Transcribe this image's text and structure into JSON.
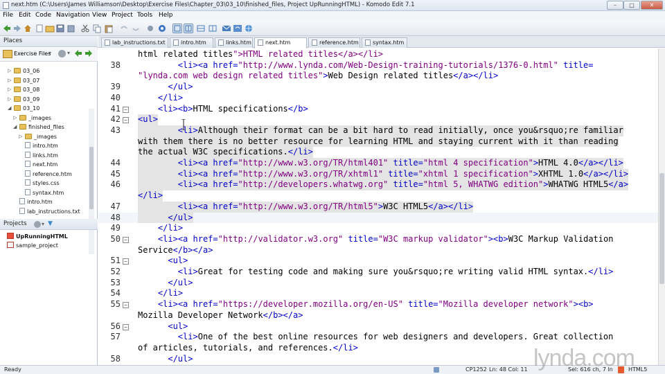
{
  "window": {
    "title": "next.htm (C:\\Users\\James Williamson\\Desktop\\Exercise Files\\Chapter_03\\03_10\\finished_files, Project UpRunningHTML) - Komodo Edit 7.1",
    "controls": [
      "minimize",
      "maximize",
      "close"
    ]
  },
  "menu": [
    "File",
    "Edit",
    "Code",
    "Navigation",
    "View",
    "Project",
    "Tools",
    "Help"
  ],
  "toolbar_icons": [
    "back-icon",
    "forward-icon",
    "home-icon",
    "new-file-icon",
    "open-file-icon",
    "save-icon",
    "save-all-icon",
    "cut-icon",
    "copy-icon",
    "paste-icon",
    "undo-icon",
    "redo-icon",
    "debug-icon",
    "browser-icon",
    "view-icon",
    "split-icon",
    "tree-icon",
    "pane-icon",
    "mail-icon",
    "refresh-icon",
    "globe-icon"
  ],
  "places": {
    "header": "Places",
    "root": "Exercise Files",
    "tree": [
      {
        "label": "03_06",
        "type": "folder",
        "level": 1,
        "expanded": false
      },
      {
        "label": "03_07",
        "type": "folder",
        "level": 1,
        "expanded": false
      },
      {
        "label": "03_08",
        "type": "folder",
        "level": 1,
        "expanded": false
      },
      {
        "label": "03_09",
        "type": "folder",
        "level": 1,
        "expanded": false
      },
      {
        "label": "03_10",
        "type": "folder",
        "level": 1,
        "expanded": true
      },
      {
        "label": "_images",
        "type": "folder",
        "level": 2,
        "expanded": false
      },
      {
        "label": "finished_files",
        "type": "folder",
        "level": 2,
        "expanded": true
      },
      {
        "label": "_images",
        "type": "folder",
        "level": 3,
        "expanded": false
      },
      {
        "label": "intro.htm",
        "type": "file",
        "level": 3
      },
      {
        "label": "links.htm",
        "type": "file",
        "level": 3
      },
      {
        "label": "next.htm",
        "type": "file",
        "level": 3
      },
      {
        "label": "reference.htm",
        "type": "file",
        "level": 3
      },
      {
        "label": "styles.css",
        "type": "file",
        "level": 3
      },
      {
        "label": "syntax.htm",
        "type": "file",
        "level": 3
      },
      {
        "label": "intro.htm",
        "type": "file",
        "level": 2
      },
      {
        "label": "lab_instructions.txt",
        "type": "file",
        "level": 2
      }
    ]
  },
  "projects": {
    "header": "Projects",
    "items": [
      {
        "label": "UpRunningHTML",
        "bold": true
      },
      {
        "label": "sample_project",
        "bold": false
      }
    ]
  },
  "tabs": [
    {
      "label": "lab_instructions.txt",
      "active": false
    },
    {
      "label": "intro.htm",
      "active": false
    },
    {
      "label": "links.htm",
      "active": false
    },
    {
      "label": "next.htm",
      "active": true
    },
    {
      "label": "reference.htm",
      "active": false
    },
    {
      "label": "syntax.htm",
      "active": false
    }
  ],
  "code_lines": [
    {
      "n": "",
      "fold": "",
      "text": "html related titles\">HTML related titles</a></li>"
    },
    {
      "n": "38",
      "fold": "",
      "text": "        <li><a href=\"http://www.lynda.com/Web-Design-training-tutorials/1376-0.html\" title="
    },
    {
      "n": "",
      "fold": "",
      "text": "\"lynda.com web design related titles\">Web Design related titles</a></li>"
    },
    {
      "n": "39",
      "fold": "",
      "text": "      </ul>"
    },
    {
      "n": "40",
      "fold": "",
      "text": "    </li>"
    },
    {
      "n": "41",
      "fold": "minus",
      "text": "    <li><b>HTML specifications</b>"
    },
    {
      "n": "42",
      "fold": "minus",
      "text": "<ul>",
      "hl": true
    },
    {
      "n": "43",
      "fold": "",
      "text": "        <li>Although their format can be a bit hard to read initially, once you&rsquo;re familiar",
      "hl": true
    },
    {
      "n": "",
      "fold": "",
      "text": "with them there is no better resource for learning HTML and staying current with it than reading",
      "hl": true
    },
    {
      "n": "",
      "fold": "",
      "text": "the actual W3C specifications.</li>",
      "hl": true
    },
    {
      "n": "44",
      "fold": "",
      "text": "        <li><a href=\"http://www.w3.org/TR/html401\" title=\"html 4 specification\">HTML 4.0</a></li>",
      "hl": true
    },
    {
      "n": "45",
      "fold": "",
      "text": "        <li><a href=\"http://www.w3.org/TR/xhtml1\" title=\"xhtml 1 specification\">XHTML 1.0</a></li>",
      "hl": true
    },
    {
      "n": "46",
      "fold": "",
      "text": "        <li><a href=\"http://developers.whatwg.org\" title=\"html 5, WHATWG edition\">WHATWG HTML5</a>",
      "hl": true
    },
    {
      "n": "",
      "fold": "",
      "text": "</li>",
      "hl": true
    },
    {
      "n": "47",
      "fold": "",
      "text": "        <li><a href=\"http://www.w3.org/TR/html5\">W3C HTML5</a></li>",
      "hl": true
    },
    {
      "n": "48",
      "fold": "",
      "text": "      </ul>",
      "hl": true,
      "current": true
    },
    {
      "n": "49",
      "fold": "",
      "text": "    </li>"
    },
    {
      "n": "50",
      "fold": "minus",
      "text": "    <li><a href=\"http://validator.w3.org\" title=\"W3C markup validator\"><b>W3C Markup Validation"
    },
    {
      "n": "",
      "fold": "",
      "text": "Service</b></a>"
    },
    {
      "n": "51",
      "fold": "minus",
      "text": "      <ul>"
    },
    {
      "n": "52",
      "fold": "",
      "text": "        <li>Great for testing code and making sure you&rsquo;re writing valid HTML syntax.</li>"
    },
    {
      "n": "53",
      "fold": "",
      "text": "      </ul>"
    },
    {
      "n": "54",
      "fold": "",
      "text": "    </li>"
    },
    {
      "n": "55",
      "fold": "minus",
      "text": "    <li><a href=\"https://developer.mozilla.org/en-US\" title=\"Mozilla developer network\"><b>"
    },
    {
      "n": "",
      "fold": "",
      "text": "Mozilla Developer Network</b></a>"
    },
    {
      "n": "56",
      "fold": "minus",
      "text": "      <ul>"
    },
    {
      "n": "57",
      "fold": "",
      "text": "        <li>One of the best online resources for web designers and developers. Great collection"
    },
    {
      "n": "",
      "fold": "",
      "text": "of articles, tutorials, and references.</li>"
    },
    {
      "n": "58",
      "fold": "",
      "text": "      </ul>"
    }
  ],
  "status": {
    "ready": "Ready",
    "encoding": "CP1252",
    "position": "Ln: 48 Col: 11",
    "selection": "Sel: 616 ch, 7 ln",
    "language": "HTML5"
  },
  "watermark": "lynda.com",
  "colors": {
    "tag": "#0000c8",
    "string": "#800080",
    "selection": "#e4e4e4"
  }
}
